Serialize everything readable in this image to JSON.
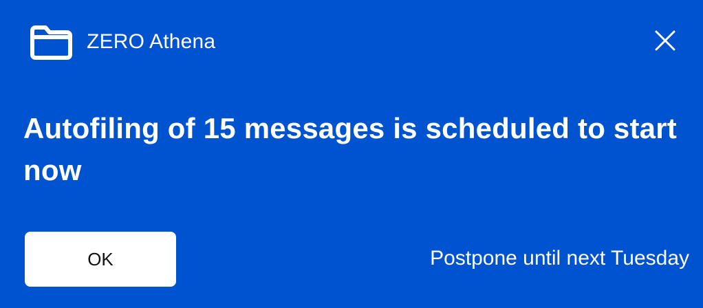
{
  "notification": {
    "app_name": "ZERO Athena",
    "app_icon": "folder-icon",
    "close_icon": "close-icon",
    "close_label": "Close",
    "message": "Autofiling of 15 messages is scheduled to start now",
    "ok_label": "OK",
    "postpone_label": "Postpone until next Tuesday"
  },
  "colors": {
    "background": "#0053cf",
    "text": "#ffffff",
    "button_background": "#ffffff",
    "button_text": "#111111"
  }
}
